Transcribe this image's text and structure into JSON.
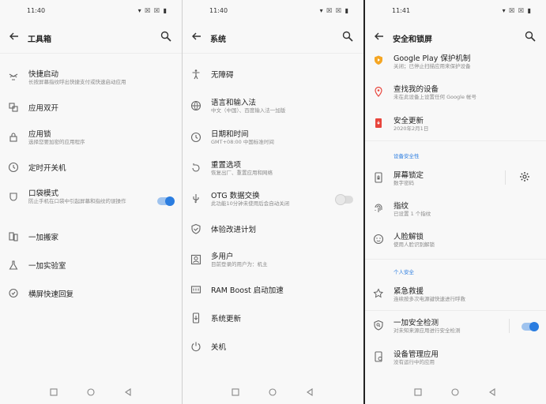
{
  "toolbox_screen": {
    "time": "11:40",
    "title": "工具箱",
    "items": [
      {
        "title": "快捷启动",
        "subtitle": "长按屏幕指纹呼出快捷支付或快速启动应用",
        "icon": "quick-launch-icon"
      },
      {
        "title": "应用双开",
        "subtitle": "",
        "icon": "parallel-apps-icon"
      },
      {
        "title": "应用锁",
        "subtitle": "选择您要加密的应用程序",
        "icon": "lock-icon"
      },
      {
        "title": "定时开关机",
        "subtitle": "",
        "icon": "clock-icon"
      },
      {
        "title": "口袋模式",
        "subtitle": "防止手机在口袋中引起屏幕和指纹的误操作",
        "icon": "pocket-icon",
        "toggle": "on"
      },
      {
        "title": "一加搬家",
        "subtitle": "",
        "icon": "clone-phone-icon"
      },
      {
        "title": "一加实验室",
        "subtitle": "",
        "icon": "flask-icon"
      },
      {
        "title": "横屏快速回复",
        "subtitle": "",
        "icon": "chat-bubble-icon"
      }
    ]
  },
  "system_screen": {
    "time": "11:40",
    "title": "系统",
    "items": [
      {
        "title": "无障碍",
        "subtitle": "",
        "icon": "accessibility-icon"
      },
      {
        "title": "语言和输入法",
        "subtitle": "中文（中国）、百度输入法一加版",
        "icon": "globe-icon"
      },
      {
        "title": "日期和时间",
        "subtitle": "GMT+08:00 中国标准时间",
        "icon": "clock-icon"
      },
      {
        "title": "重置选项",
        "subtitle": "恢复出厂、重置应用和网络",
        "icon": "reset-icon"
      },
      {
        "title": "OTG 数据交换",
        "subtitle": "此功能10分钟未使用后会自动关闭",
        "icon": "usb-icon",
        "toggle": "off"
      },
      {
        "title": "体验改进计划",
        "subtitle": "",
        "icon": "shield-check-icon"
      },
      {
        "title": "多用户",
        "subtitle": "目前登录的用户为：机主",
        "icon": "user-icon"
      },
      {
        "title": "RAM Boost 启动加速",
        "subtitle": "",
        "icon": "ram-icon"
      },
      {
        "title": "系统更新",
        "subtitle": "",
        "icon": "system-update-icon"
      },
      {
        "title": "关机",
        "subtitle": "",
        "icon": "power-icon"
      }
    ]
  },
  "security_screen": {
    "time": "11:41",
    "title": "安全和锁屏",
    "items": [
      {
        "title": "Google Play 保护机制",
        "subtitle": "关闭；已停止扫描应用来保护设备",
        "icon": "play-protect-icon"
      },
      {
        "title": "查找我的设备",
        "subtitle": "未在此设备上设置任何 Google 帐号",
        "icon": "location-pin-icon"
      },
      {
        "title": "安全更新",
        "subtitle": "2020年2月1日",
        "icon": "security-update-icon"
      }
    ],
    "section_device": "设备安全性",
    "device_items": [
      {
        "title": "屏幕锁定",
        "subtitle": "数字密码",
        "icon": "phone-lock-icon"
      },
      {
        "title": "指纹",
        "subtitle": "已设置 1 个指纹",
        "icon": "fingerprint-icon"
      },
      {
        "title": "人脸解锁",
        "subtitle": "使用人脸识别解锁",
        "icon": "face-icon"
      }
    ],
    "section_personal": "个人安全",
    "personal_items": [
      {
        "title": "紧急救援",
        "subtitle": "连续按多次电源键快速进行呼救",
        "icon": "emergency-icon"
      },
      {
        "title": "一加安全检测",
        "subtitle": "对未知来源应用进行安全检测",
        "icon": "security-scan-icon",
        "toggle": "on"
      },
      {
        "title": "设备管理应用",
        "subtitle": "没有运行中的应用",
        "icon": "device-admin-icon"
      }
    ]
  },
  "colors": {
    "accent": "#2b7de0",
    "background": "#f8f8f8",
    "google_play_icon": "#f5a623",
    "find_device_icon": "#e8453c",
    "security_update_icon": "#e8453c"
  }
}
